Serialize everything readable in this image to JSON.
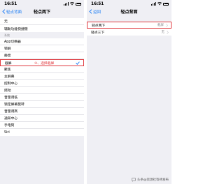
{
  "left_screen": {
    "time": "16:51",
    "back_label": "轻点背面",
    "title": "轻点两下",
    "group1": [
      "无",
      "辅助功能快捷键"
    ],
    "section_header": "系统",
    "system_items": [
      {
        "label": "App切换器",
        "selected": false
      },
      {
        "label": "锁屏",
        "selected": false
      },
      {
        "label": "静音",
        "selected": false
      },
      {
        "label": "截屏",
        "selected": true,
        "annotation": "③、选择截屏"
      },
      {
        "label": "聚焦",
        "selected": false
      },
      {
        "label": "主屏幕",
        "selected": false
      },
      {
        "label": "控制中心",
        "selected": false
      },
      {
        "label": "摇动",
        "selected": false
      },
      {
        "label": "音量调低",
        "selected": false
      },
      {
        "label": "锁定屏幕旋转",
        "selected": false
      },
      {
        "label": "音量调高",
        "selected": false
      },
      {
        "label": "通知中心",
        "selected": false
      },
      {
        "label": "手电筒",
        "selected": false
      },
      {
        "label": "Siri",
        "selected": false
      }
    ]
  },
  "right_screen": {
    "time": "16:51",
    "back_label": "返回",
    "title": "轻点背面",
    "rows": [
      {
        "label": "轻点两下",
        "value": "截屏",
        "highlighted": true
      },
      {
        "label": "轻点三下",
        "value": "无",
        "highlighted": false
      }
    ]
  },
  "watermark": {
    "text": "头条@资源社等待发布",
    "icon": "speech-bubble-icon"
  },
  "colors": {
    "accent_blue": "#1a7cf5",
    "annotation_red": "#e0393e",
    "background_gray": "#efeff4"
  }
}
